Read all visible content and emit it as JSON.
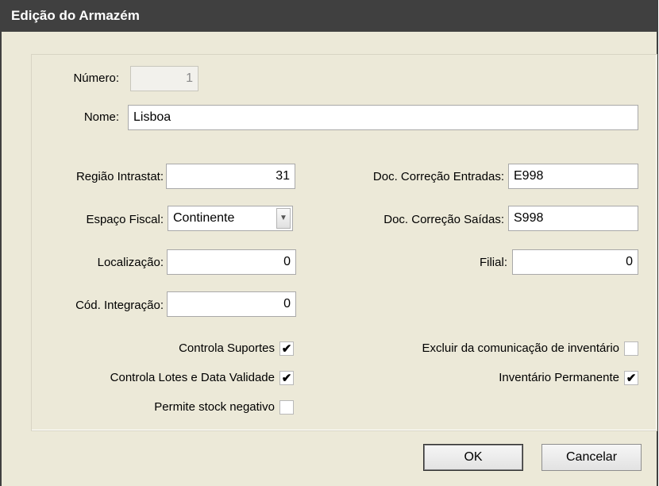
{
  "dialog": {
    "title": "Edição do Armazém"
  },
  "fields": {
    "numero": {
      "label": "Número:",
      "value": "1"
    },
    "nome": {
      "label": "Nome:",
      "value": "Lisboa"
    },
    "regiao_intrastat": {
      "label": "Região Intrastat:",
      "value": "31"
    },
    "espaco_fiscal": {
      "label": "Espaço Fiscal:",
      "value": "Continente"
    },
    "localizacao": {
      "label": "Localização:",
      "value": "0"
    },
    "cod_integracao": {
      "label": "Cód. Integração:",
      "value": "0"
    },
    "doc_correcao_entradas": {
      "label": "Doc. Correção  Entradas:",
      "value": "E998"
    },
    "doc_correcao_saidas": {
      "label": "Doc. Correção Saídas:",
      "value": "S998"
    },
    "filial": {
      "label": "Filial:",
      "value": "0"
    }
  },
  "checkboxes": {
    "controla_suportes": {
      "label": "Controla Suportes",
      "checked": true,
      "mark": "✔"
    },
    "controla_lotes": {
      "label": "Controla Lotes e Data Validade",
      "checked": true,
      "mark": "✔"
    },
    "permite_stock_negativo": {
      "label": "Permite stock negativo",
      "checked": false,
      "mark": ""
    },
    "excluir_comunicacao": {
      "label": "Excluir da comunicação de inventário",
      "checked": false,
      "mark": ""
    },
    "inventario_permanente": {
      "label": "Inventário Permanente",
      "checked": true,
      "mark": "✔"
    }
  },
  "buttons": {
    "ok": "OK",
    "cancel": "Cancelar"
  }
}
